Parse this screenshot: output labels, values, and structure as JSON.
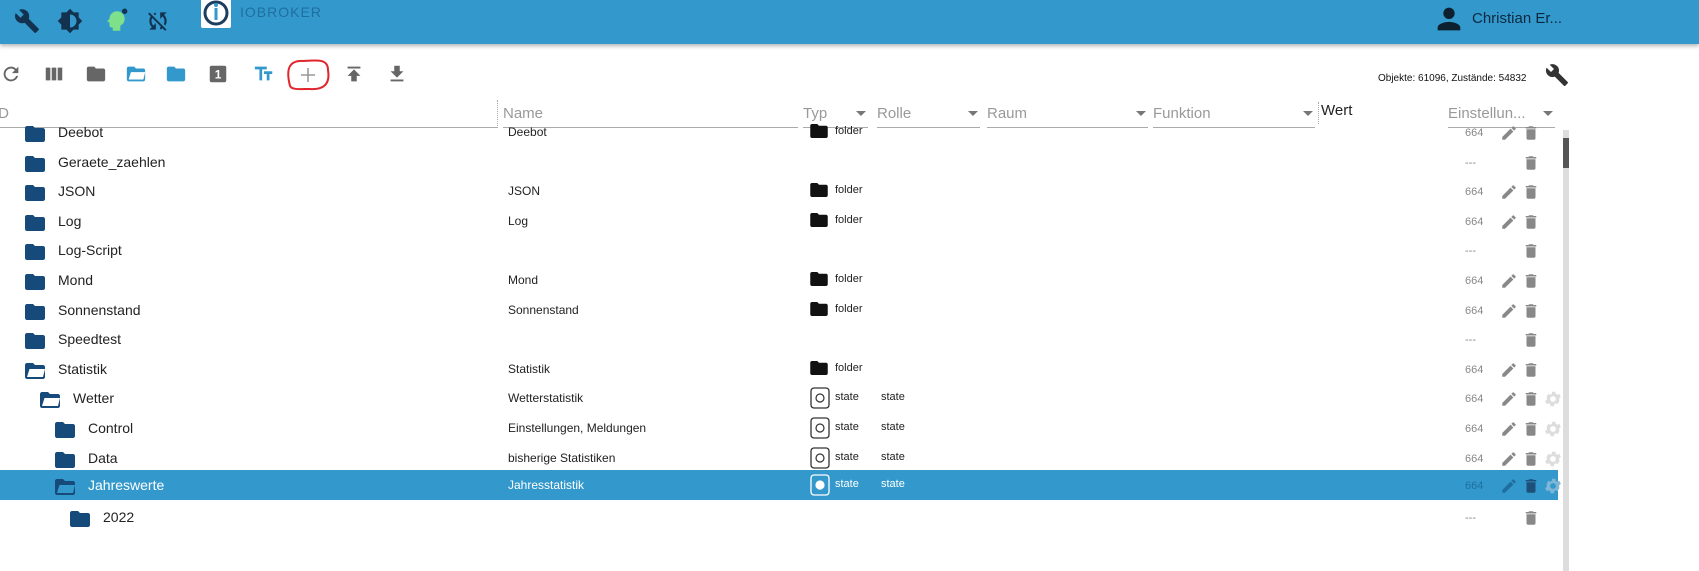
{
  "header": {
    "brand": "IOBROKER",
    "user": "Christian Er..."
  },
  "toolbar": {
    "stats": "Objekte: 61096, Zustände: 54832"
  },
  "columns": {
    "id": "ID",
    "name": "Name",
    "type": "Typ",
    "role": "Rolle",
    "room": "Raum",
    "function": "Funktion",
    "value": "Wert",
    "settings": "Einstellun..."
  },
  "rows": [
    {
      "id": "Deebot",
      "name": "Deebot",
      "type": "folder",
      "role": "",
      "acl": "664",
      "level": 0,
      "open": false,
      "kind": "folder"
    },
    {
      "id": "Geraete_zaehlen",
      "name": "",
      "type": "",
      "role": "",
      "acl": "---",
      "level": 0,
      "open": false,
      "kind": "none"
    },
    {
      "id": "JSON",
      "name": "JSON",
      "type": "folder",
      "role": "",
      "acl": "664",
      "level": 0,
      "open": false,
      "kind": "folder"
    },
    {
      "id": "Log",
      "name": "Log",
      "type": "folder",
      "role": "",
      "acl": "664",
      "level": 0,
      "open": false,
      "kind": "folder"
    },
    {
      "id": "Log-Script",
      "name": "",
      "type": "",
      "role": "",
      "acl": "---",
      "level": 0,
      "open": false,
      "kind": "none"
    },
    {
      "id": "Mond",
      "name": "Mond",
      "type": "folder",
      "role": "",
      "acl": "664",
      "level": 0,
      "open": false,
      "kind": "folder"
    },
    {
      "id": "Sonnenstand",
      "name": "Sonnenstand",
      "type": "folder",
      "role": "",
      "acl": "664",
      "level": 0,
      "open": false,
      "kind": "folder"
    },
    {
      "id": "Speedtest",
      "name": "",
      "type": "",
      "role": "",
      "acl": "---",
      "level": 0,
      "open": false,
      "kind": "none"
    },
    {
      "id": "Statistik",
      "name": "Statistik",
      "type": "folder",
      "role": "",
      "acl": "664",
      "level": 0,
      "open": true,
      "kind": "folder"
    },
    {
      "id": "Wetter",
      "name": "Wetterstatistik",
      "type": "state",
      "role": "state",
      "acl": "664",
      "level": 1,
      "open": true,
      "kind": "state"
    },
    {
      "id": "Control",
      "name": "Einstellungen, Meldungen",
      "type": "state",
      "role": "state",
      "acl": "664",
      "level": 2,
      "open": false,
      "kind": "state"
    },
    {
      "id": "Data",
      "name": "bisherige Statistiken",
      "type": "state",
      "role": "state",
      "acl": "664",
      "level": 2,
      "open": false,
      "kind": "state"
    },
    {
      "id": "Jahreswerte",
      "name": "Jahresstatistik",
      "type": "state",
      "role": "state",
      "acl": "664",
      "level": 2,
      "open": true,
      "kind": "state",
      "selected": true
    },
    {
      "id": "2022",
      "name": "",
      "type": "",
      "role": "",
      "acl": "---",
      "level": 3,
      "open": false,
      "kind": "none"
    }
  ],
  "colors": {
    "appbar": "#3399cc",
    "folder": "#164a7a",
    "selected": "#3399cc",
    "annotation": "#e0262c"
  }
}
